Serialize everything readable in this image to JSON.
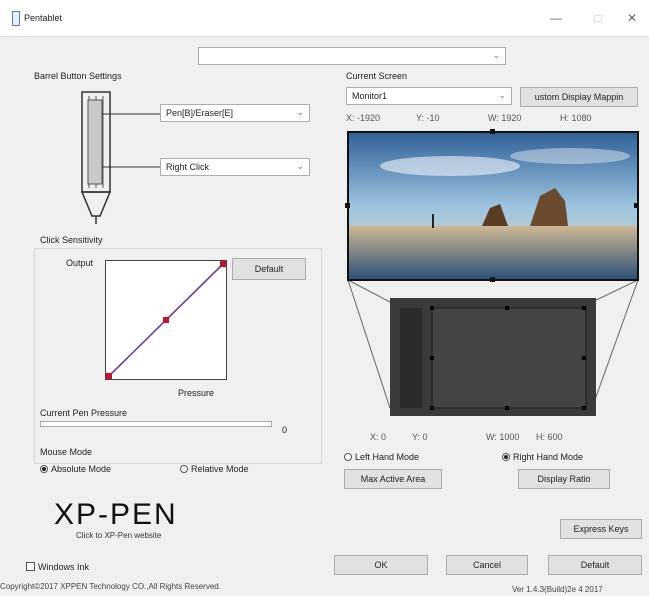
{
  "window": {
    "title": "Pentablet",
    "minimize": "—",
    "maximize": "□",
    "close": "✕"
  },
  "device_select": {
    "value": "",
    "arrow": "⌄"
  },
  "barrel": {
    "title": "Barrel Button Settings",
    "upper": {
      "value": "Pen[B]/Eraser[E]",
      "arrow": "⌄"
    },
    "lower": {
      "value": "Right Click",
      "arrow": "⌄"
    }
  },
  "click_sensitivity": {
    "title": "Click Sensitivity",
    "output_label": "Output",
    "pressure_label": "Pressure",
    "default_label": "Default",
    "curve_points": [
      [
        0,
        0
      ],
      [
        0.5,
        0.5
      ],
      [
        1,
        1
      ]
    ]
  },
  "pen_pressure": {
    "label": "Current Pen Pressure",
    "value": "0",
    "fraction": 0
  },
  "mouse_mode": {
    "title": "Mouse Mode",
    "absolute": "Absolute Mode",
    "relative": "Relative Mode",
    "selected": "absolute"
  },
  "screen": {
    "title": "Current Screen",
    "monitor": {
      "value": "Monitor1",
      "arrow": "⌄"
    },
    "custom_mapping_label": "ustom Display Mappin",
    "x": "X: -1920",
    "y": "Y: -10",
    "w": "W: 1920",
    "h": "H: 1080"
  },
  "tablet": {
    "x": "X: 0",
    "y": "Y: 0",
    "w": "W: 1000",
    "h": "H: 600",
    "left_hand": "Left Hand Mode",
    "right_hand": "Right Hand Mode",
    "selected_hand": "right",
    "max_area": "Max Active Area",
    "display_ratio": "Display Ratio"
  },
  "brand": {
    "logo": "XP-PEN",
    "link": "Click to XP-Pen website"
  },
  "footer": {
    "windows_ink": "Windows Ink",
    "express_keys": "Express Keys",
    "ok": "OK",
    "cancel": "Cancel",
    "default": "Default",
    "copyright": "Copyright©2017  XPPEN  Technology  CO.,All  Rights  Reserved.",
    "version": "Ver 1.4.3(Build)2e  4 2017"
  },
  "colors": {
    "accent": "#6b3fa0",
    "point": "#c8102e"
  }
}
